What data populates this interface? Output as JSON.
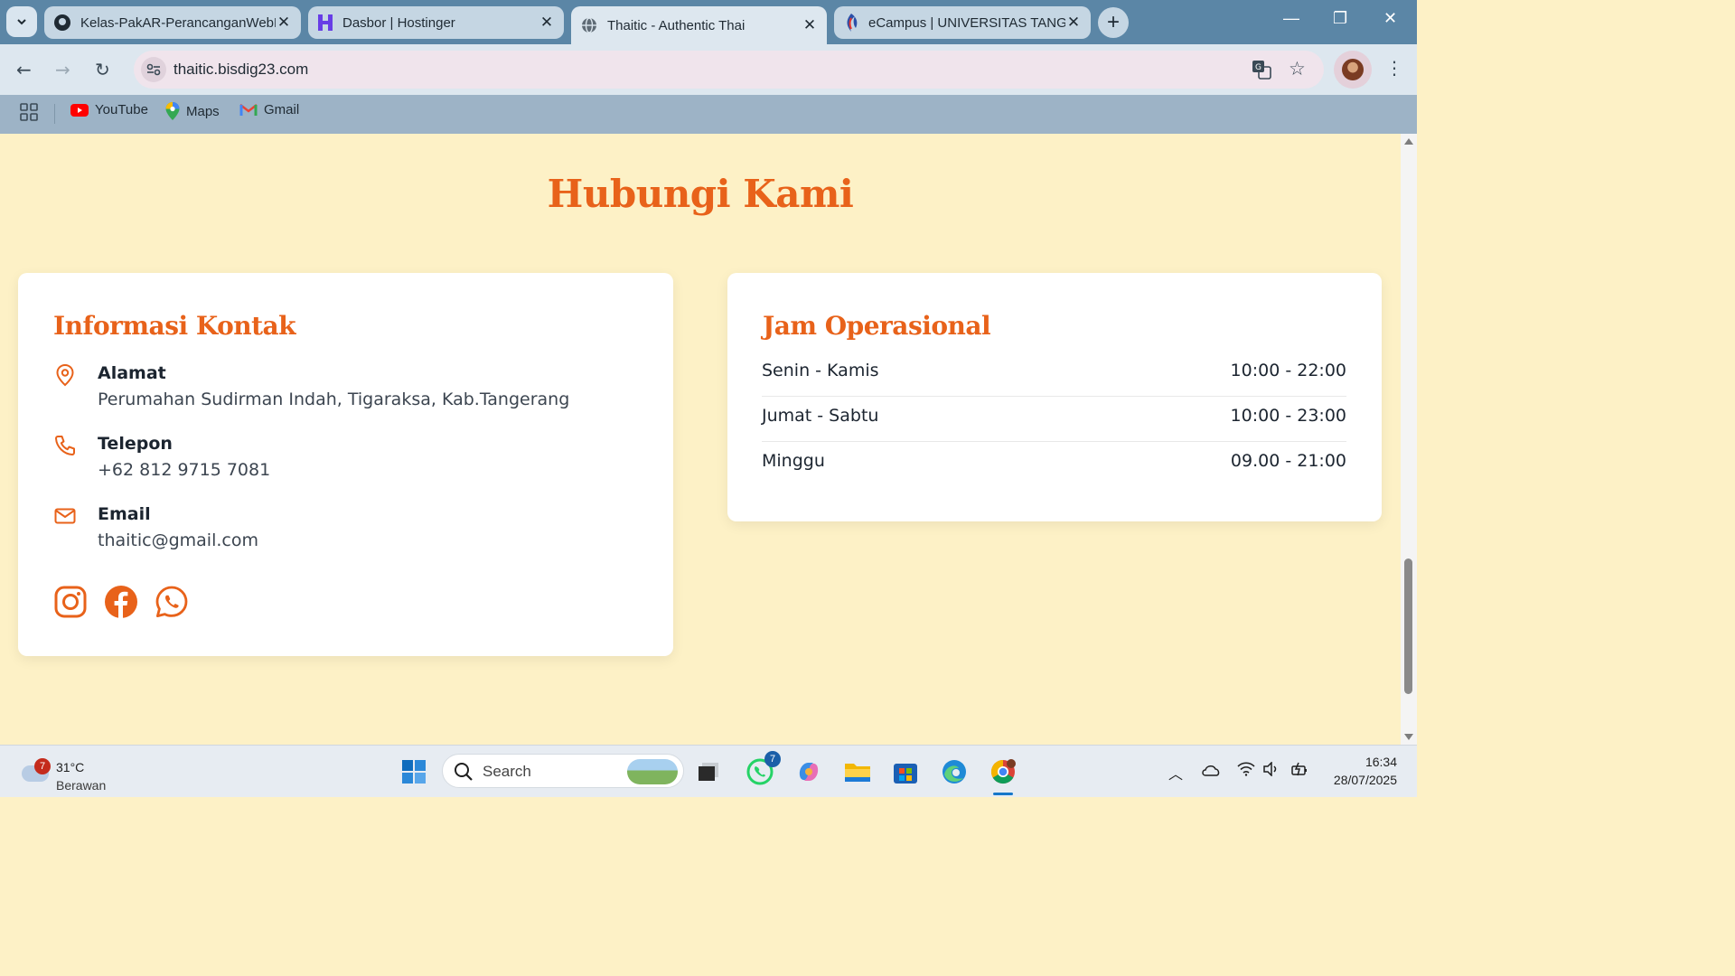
{
  "browser": {
    "tabs": [
      {
        "title": "Kelas-PakAR-PerancanganWebP",
        "icon": "github-icon"
      },
      {
        "title": "Dasbor | Hostinger",
        "icon": "hostinger-icon"
      },
      {
        "title": "Thaitic - Authentic Thai",
        "icon": "globe-icon"
      },
      {
        "title": "eCampus | UNIVERSITAS TANGE",
        "icon": "ecampus-icon"
      }
    ],
    "active_tab": 2,
    "url": "thaitic.bisdig23.com",
    "bookmarks": [
      {
        "label": "YouTube",
        "icon": "youtube-icon"
      },
      {
        "label": "Maps",
        "icon": "maps-icon"
      },
      {
        "label": "Gmail",
        "icon": "gmail-icon"
      }
    ]
  },
  "page": {
    "title": "Hubungi Kami",
    "contact": {
      "heading": "Informasi Kontak",
      "items": [
        {
          "label": "Alamat",
          "value": "Perumahan Sudirman Indah, Tigaraksa, Kab.Tangerang",
          "icon": "location-pin-icon"
        },
        {
          "label": "Telepon",
          "value": "+62 812 9715 7081",
          "icon": "phone-icon"
        },
        {
          "label": "Email",
          "value": "thaitic@gmail.com",
          "icon": "mail-icon"
        }
      ],
      "socials": [
        "instagram-icon",
        "facebook-icon",
        "whatsapp-icon"
      ]
    },
    "hours": {
      "heading": "Jam Operasional",
      "rows": [
        {
          "day": "Senin - Kamis",
          "time": "10:00 - 22:00"
        },
        {
          "day": "Jumat - Sabtu",
          "time": "10:00 - 23:00"
        },
        {
          "day": "Minggu",
          "time": "09.00 - 21:00"
        }
      ]
    }
  },
  "taskbar": {
    "weather": {
      "badge": "7",
      "temp": "31°C",
      "condition": "Berawan"
    },
    "search_placeholder": "Search",
    "whatsapp_badge": "7",
    "time": "16:34",
    "date": "28/07/2025"
  },
  "colors": {
    "accent": "#e8621a",
    "page_background": "#fdf1c6",
    "tabbar": "#5b86a6"
  }
}
